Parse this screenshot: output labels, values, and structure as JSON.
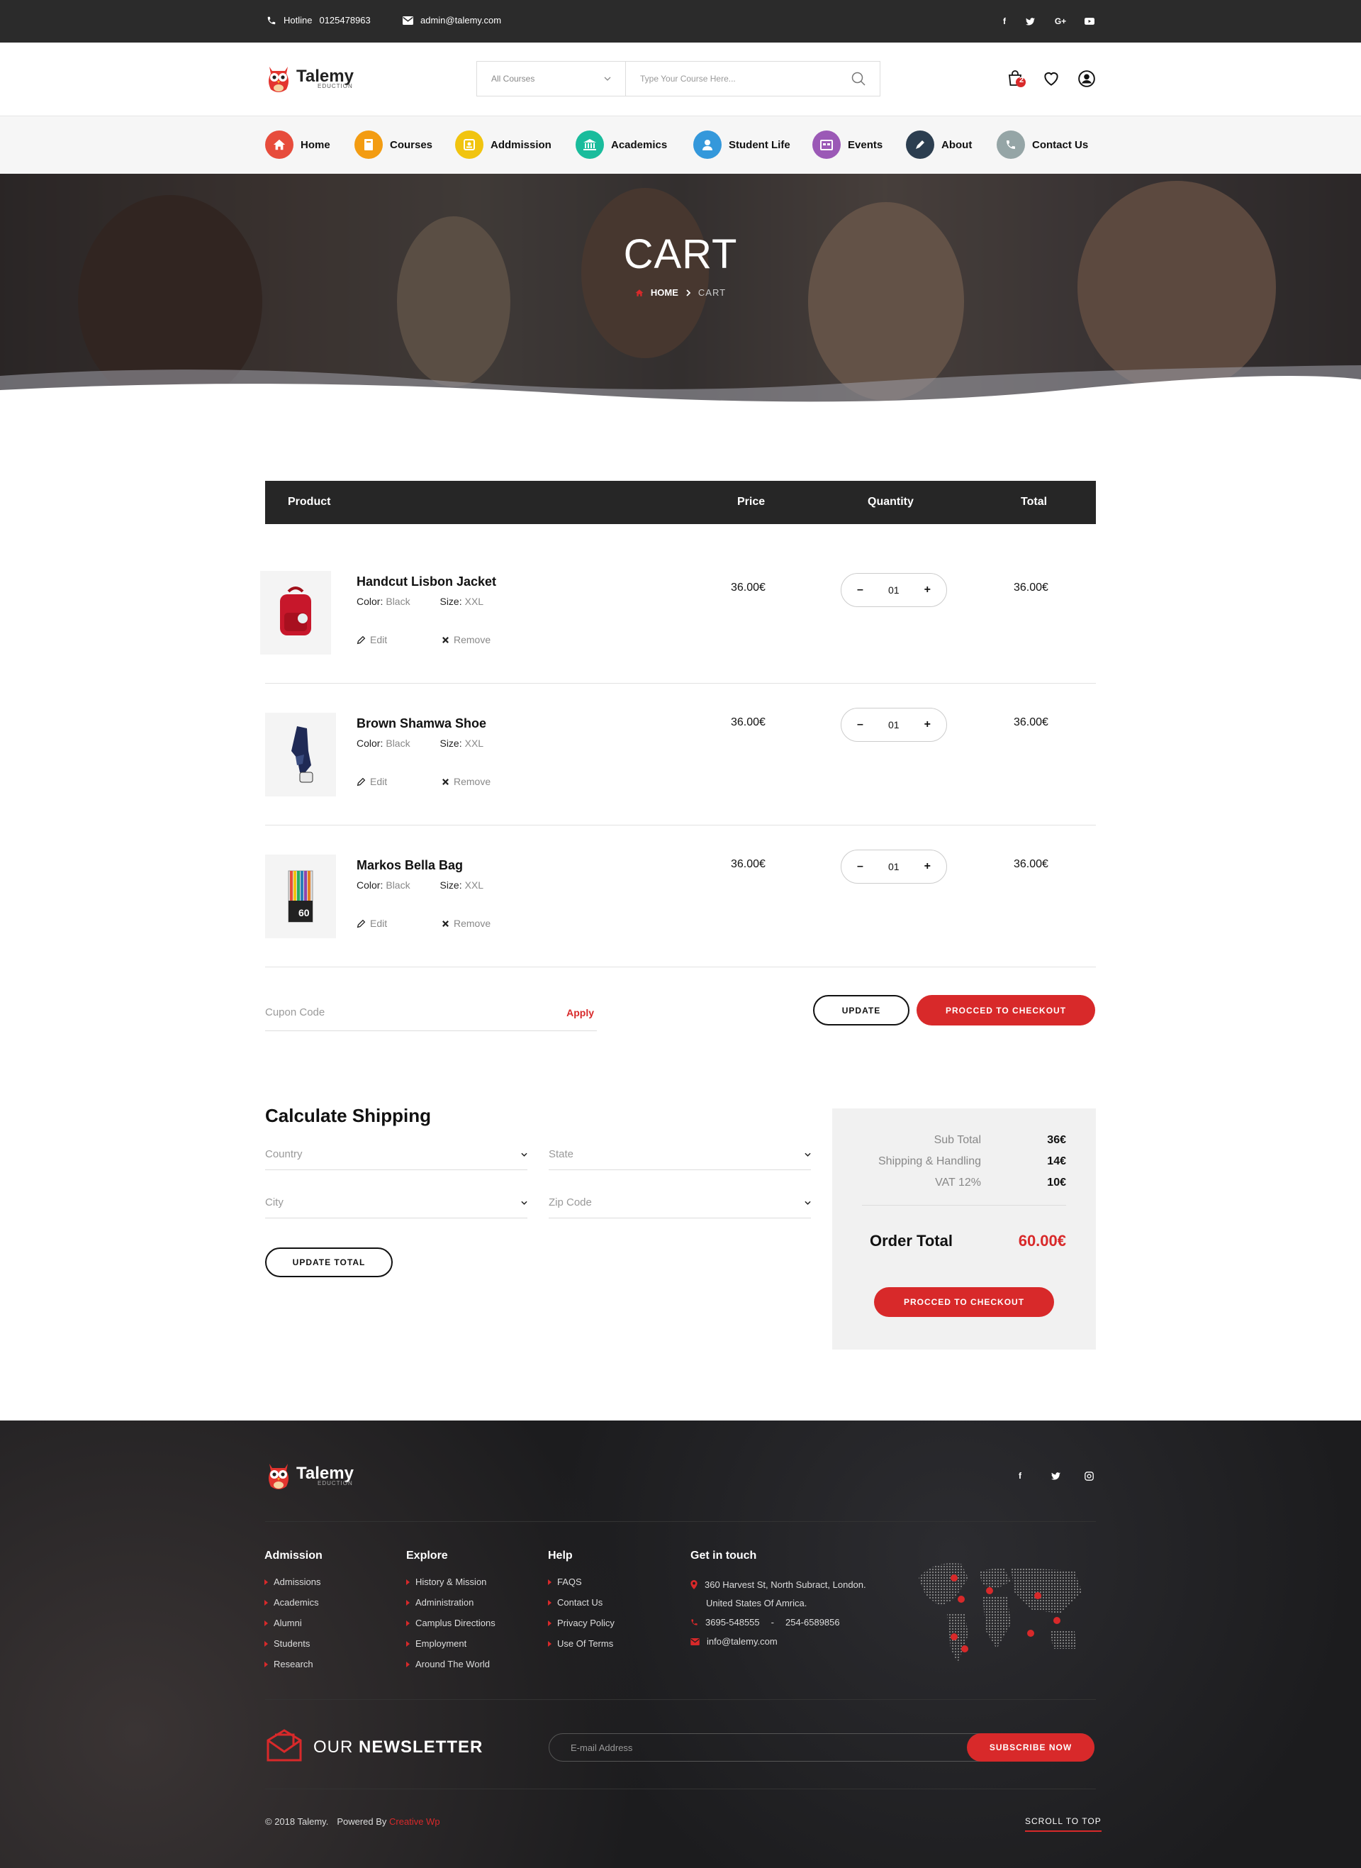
{
  "topbar": {
    "hotline_label": "Hotline",
    "hotline_number": "0125478963",
    "email": "admin@talemy.com",
    "social": [
      "f",
      "t",
      "G+",
      "yt"
    ]
  },
  "brand": {
    "name": "Talemy",
    "tagline": "EDUCTION"
  },
  "search": {
    "category": "All Courses",
    "placeholder": "Type Your Course Here..."
  },
  "cart_badge": "2",
  "nav": [
    {
      "label": "Home",
      "color": "#e74c3c"
    },
    {
      "label": "Courses",
      "color": "#f39c12"
    },
    {
      "label": "Addmission",
      "color": "#f1c40f"
    },
    {
      "label": "Academics",
      "color": "#1abc9c"
    },
    {
      "label": "Student Life",
      "color": "#3498db"
    },
    {
      "label": "Events",
      "color": "#9b59b6"
    },
    {
      "label": "About",
      "color": "#34495e"
    },
    {
      "label": "Contact Us",
      "color": "#95a5a6"
    }
  ],
  "hero": {
    "title": "CART",
    "crumb_home": "HOME",
    "crumb_current": "CART"
  },
  "table": {
    "product": "Product",
    "price": "Price",
    "quantity": "Quantity",
    "total": "Total"
  },
  "items": [
    {
      "name": "Handcut Lisbon Jacket",
      "color_label": "Color:",
      "color": "Black",
      "size_label": "Size:",
      "size": "XXL",
      "edit": "Edit",
      "remove": "Remove",
      "price": "36.00€",
      "qty": "01",
      "total": "36.00€"
    },
    {
      "name": "Brown Shamwa Shoe",
      "color_label": "Color:",
      "color": "Black",
      "size_label": "Size:",
      "size": "XXL",
      "edit": "Edit",
      "remove": "Remove",
      "price": "36.00€",
      "qty": "01",
      "total": "36.00€"
    },
    {
      "name": "Markos Bella Bag",
      "color_label": "Color:",
      "color": "Black",
      "size_label": "Size:",
      "size": "XXL",
      "edit": "Edit",
      "remove": "Remove",
      "price": "36.00€",
      "qty": "01",
      "total": "36.00€"
    }
  ],
  "qty_minus": "–",
  "qty_plus": "+",
  "coupon": {
    "placeholder": "Cupon Code",
    "apply": "Apply"
  },
  "buttons": {
    "update": "UPDATE",
    "checkout": "PROCCED TO CHECKOUT",
    "update_total": "UPDATE TOTAL"
  },
  "shipping": {
    "title": "Calculate Shipping",
    "country": "Country",
    "state": "State",
    "city": "City",
    "zip": "Zip Code"
  },
  "summary": {
    "sub_total_label": "Sub Total",
    "sub_total": "36€",
    "shipping_label": "Shipping & Handling",
    "shipping": "14€",
    "vat_label": "VAT 12%",
    "vat": "10€",
    "order_total_label": "Order Total",
    "order_total": "60.00€"
  },
  "footer": {
    "admission": {
      "title": "Admission",
      "links": [
        "Admissions",
        "Academics",
        "Alumni",
        "Students",
        "Research"
      ]
    },
    "explore": {
      "title": "Explore",
      "links": [
        "History & Mission",
        "Administration",
        "Camplus Directions",
        "Employment",
        "Around The World"
      ]
    },
    "help": {
      "title": "Help",
      "links": [
        "FAQS",
        "Contact Us",
        "Privacy Policy",
        "Use Of Terms"
      ]
    },
    "contact": {
      "title": "Get in touch",
      "address1": "360 Harvest St, North Subract, London.",
      "address2": "United States Of Amrica.",
      "phone1": "3695-548555",
      "phone_sep": "-",
      "phone2": "254-6589856",
      "email": "info@talemy.com"
    },
    "newsletter_our": "OUR",
    "newsletter_word": "NEWSLETTER",
    "newsletter_placeholder": "E-mail Address",
    "subscribe": "SUBSCRIBE NOW",
    "copyright": "© 2018 Talemy.",
    "powered": "Powered By",
    "powered_by": "Creative Wp",
    "scroll": "SCROLL TO TOP"
  },
  "colors": {
    "accent": "#d8292a",
    "dark": "#262626"
  }
}
